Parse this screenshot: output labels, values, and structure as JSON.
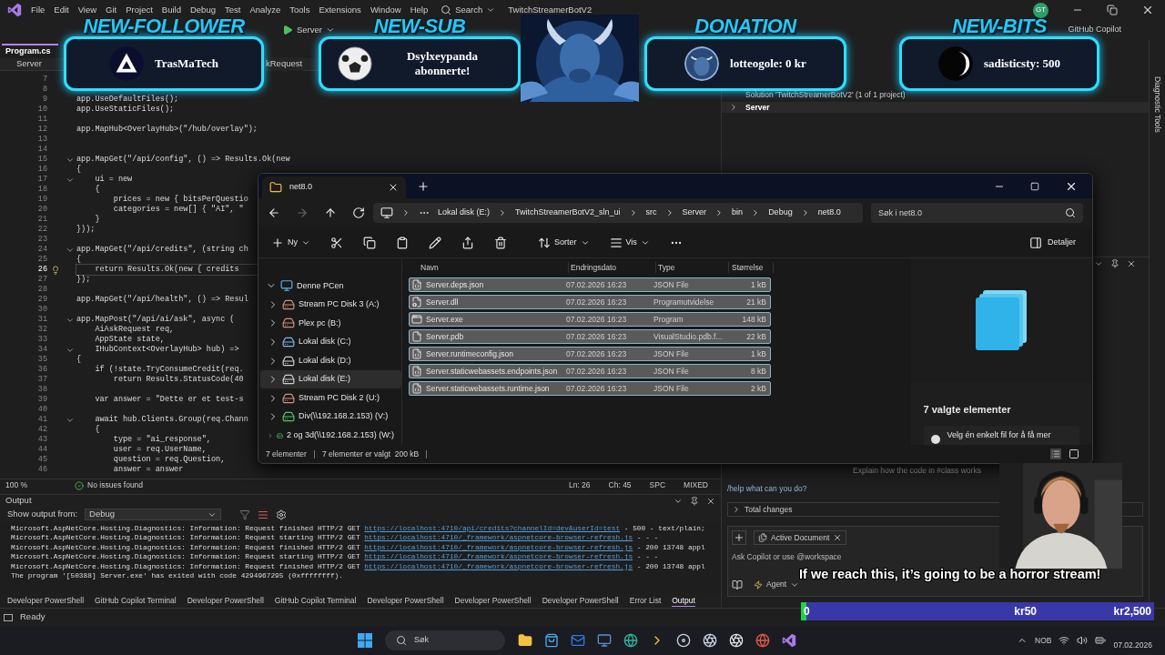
{
  "vs": {
    "title": "TwitchStreamerBotV2",
    "menu": [
      "File",
      "Edit",
      "View",
      "Git",
      "Project",
      "Build",
      "Debug",
      "Test",
      "Analyze",
      "Tools",
      "Extensions",
      "Window",
      "Help"
    ],
    "search": "Search",
    "account": "GT",
    "run_target": "Server",
    "copilot": "GitHub Copilot",
    "side_tab": "Diagnostic Tools"
  },
  "editor": {
    "tab": "Program.cs",
    "nav": [
      "Server",
      "kRequest"
    ],
    "lines": [
      {
        "n": "7",
        "fold": false,
        "current": false
      },
      {
        "n": "8",
        "fold": false,
        "current": false
      },
      {
        "n": "9",
        "code": "app.UseDefaultFiles();",
        "fold": false,
        "current": false
      },
      {
        "n": "10",
        "code": "app.UseStaticFiles();",
        "fold": false,
        "current": false
      },
      {
        "n": "11",
        "fold": false,
        "current": false
      },
      {
        "n": "12",
        "code": "app.MapHub<OverlayHub>(\"/hub/overlay\");",
        "fold": false,
        "current": false
      },
      {
        "n": "13",
        "fold": false,
        "current": false
      },
      {
        "n": "14",
        "fold": false,
        "current": false
      },
      {
        "n": "15",
        "code": "app.MapGet(\"/api/config\", () => Results.Ok(new",
        "fold": true,
        "current": false
      },
      {
        "n": "16",
        "code": "{",
        "fold": false,
        "current": false
      },
      {
        "n": "17",
        "code": "    ui = new",
        "fold": true,
        "current": false
      },
      {
        "n": "18",
        "code": "    {",
        "fold": false,
        "current": false
      },
      {
        "n": "19",
        "code": "        prices = new { bitsPerQuestio",
        "fold": false,
        "current": false
      },
      {
        "n": "20",
        "code": "        categories = new[] { \"AI\", \"",
        "fold": false,
        "current": false
      },
      {
        "n": "21",
        "code": "    }",
        "fold": false,
        "current": false
      },
      {
        "n": "22",
        "code": "}));",
        "fold": false,
        "current": false
      },
      {
        "n": "23",
        "fold": false,
        "current": false
      },
      {
        "n": "24",
        "code": "app.MapGet(\"/api/credits\", (string ch",
        "fold": true,
        "current": false
      },
      {
        "n": "25",
        "code": "{",
        "fold": false,
        "current": false
      },
      {
        "n": "26",
        "code": "    return Results.Ok(new { credits",
        "fold": false,
        "current": true
      },
      {
        "n": "27",
        "code": "});",
        "fold": false,
        "current": false
      },
      {
        "n": "28",
        "fold": false,
        "current": false
      },
      {
        "n": "29",
        "code": "app.MapGet(\"/api/health\", () => Resul",
        "fold": false,
        "current": false
      },
      {
        "n": "30",
        "fold": false,
        "current": false
      },
      {
        "n": "31",
        "code": "app.MapPost(\"/api/ai/ask\", async (",
        "fold": true,
        "current": false
      },
      {
        "n": "32",
        "code": "    AiAskRequest req,",
        "fold": false,
        "current": false
      },
      {
        "n": "33",
        "code": "    AppState state,",
        "fold": false,
        "current": false
      },
      {
        "n": "34",
        "code": "    IHubContext<OverlayHub> hub) =>",
        "fold": true,
        "current": false
      },
      {
        "n": "35",
        "code": "{",
        "fold": false,
        "current": false
      },
      {
        "n": "36",
        "code": "    if (!state.TryConsumeCredit(req.",
        "fold": false,
        "current": false
      },
      {
        "n": "37",
        "code": "        return Results.StatusCode(40",
        "fold": false,
        "current": false
      },
      {
        "n": "38",
        "fold": false,
        "current": false
      },
      {
        "n": "39",
        "code": "    var answer = \"Dette er et test-s",
        "fold": false,
        "current": false
      },
      {
        "n": "40",
        "fold": false,
        "current": false
      },
      {
        "n": "41",
        "code": "    await hub.Clients.Group(req.Chann",
        "fold": true,
        "current": false
      },
      {
        "n": "42",
        "code": "    {",
        "fold": false,
        "current": false
      },
      {
        "n": "43",
        "code": "        type = \"ai_response\",",
        "fold": false,
        "current": false
      },
      {
        "n": "44",
        "code": "        user = req.UserName,",
        "fold": false,
        "current": false
      },
      {
        "n": "45",
        "code": "        question = req.Question,",
        "fold": false,
        "current": false
      },
      {
        "n": "46",
        "code": "        answer = answer",
        "fold": false,
        "current": false
      }
    ],
    "zoom": "100 %",
    "issues": "No issues found",
    "position": [
      "Ln: 26",
      "Ch: 45",
      "SPC",
      "MIXED"
    ]
  },
  "solution": {
    "title": "Solution 'TwitchStreamerBotV2' (1 of 1 project)",
    "items": [
      {
        "label": "Server",
        "expanded": false
      }
    ]
  },
  "chat": {
    "hint": "Explain how the code in #class works",
    "suggestion": "/help what can you do?",
    "changes": "Total changes",
    "context": "Active Document",
    "input_placeholder": "Ask Copilot or use @workspace",
    "mode": "Agent"
  },
  "output": {
    "title": "Output",
    "source_label": "Show output from:",
    "source": "Debug",
    "lines": [
      {
        "text": "Microsoft.AspNetCore.Hosting.Diagnostics: Information: Request finished HTTP/2 GET ",
        "link": "https://localhost:4710/api/credits?channelId=dev&userId=test",
        "tail": " - 500 - text/plain;"
      },
      {
        "text": "Microsoft.AspNetCore.Hosting.Diagnostics: Information: Request starting HTTP/2 GET ",
        "link": "https://localhost:4710/_framework/aspnetcore-browser-refresh.js",
        "tail": " - - -"
      },
      {
        "text": "Microsoft.AspNetCore.Hosting.Diagnostics: Information: Request finished HTTP/2 GET ",
        "link": "https://localhost:4710/_framework/aspnetcore-browser-refresh.js",
        "tail": " - 200 13748 appl"
      },
      {
        "text": "Microsoft.AspNetCore.Hosting.Diagnostics: Information: Request starting HTTP/2 GET ",
        "link": "https://localhost:4710/_framework/aspnetcore-browser-refresh.js",
        "tail": " - - -"
      },
      {
        "text": "Microsoft.AspNetCore.Hosting.Diagnostics: Information: Request finished HTTP/2 GET ",
        "link": "https://localhost:4710/_framework/aspnetcore-browser-refresh.js",
        "tail": " - 200 13748 appl"
      },
      {
        "text": "The program '[50388] Server.exe' has exited with code 4294967295 (0xffffffff)."
      }
    ]
  },
  "bottom_tabs": [
    {
      "label": "Developer PowerShell",
      "selected": false
    },
    {
      "label": "GitHub Copilot Terminal",
      "selected": false
    },
    {
      "label": "Developer PowerShell",
      "selected": false
    },
    {
      "label": "GitHub Copilot Terminal",
      "selected": false
    },
    {
      "label": "Developer PowerShell",
      "selected": false
    },
    {
      "label": "Developer PowerShell",
      "selected": false
    },
    {
      "label": "Developer PowerShell",
      "selected": false
    },
    {
      "label": "Error List",
      "selected": false
    },
    {
      "label": "Output",
      "selected": true
    }
  ],
  "status": "Ready",
  "explorer": {
    "tab": "net8.0",
    "breadcrumbs": [
      "Lokal disk (E:)",
      "TwitchStreamerBotV2_sln_ui",
      "src",
      "Server",
      "bin",
      "Debug",
      "net8.0"
    ],
    "search_placeholder": "Søk i net8.0",
    "commands": [
      {
        "label": "Ny",
        "kind": "new"
      },
      {
        "kind": "cut"
      },
      {
        "kind": "copy"
      },
      {
        "kind": "paste"
      },
      {
        "kind": "rename"
      },
      {
        "kind": "share"
      },
      {
        "kind": "delete"
      },
      {
        "label": "Sorter",
        "kind": "sort"
      },
      {
        "label": "Vis",
        "kind": "view"
      },
      {
        "kind": "more"
      }
    ],
    "details_button": "Detaljer",
    "tree": [
      {
        "label": "Denne PCen",
        "kind": "pc",
        "expanded": true,
        "selected": false,
        "children": [
          {
            "label": "Stream PC Disk 3 (A:)",
            "kind": "usb",
            "expanded": false,
            "selected": false
          },
          {
            "label": "Plex pc (B:)",
            "kind": "usb",
            "expanded": false,
            "selected": false
          },
          {
            "label": "Lokal disk (C:)",
            "kind": "system",
            "expanded": false,
            "selected": false
          },
          {
            "label": "Lokal disk (D:)",
            "kind": "drive",
            "expanded": false,
            "selected": false
          },
          {
            "label": "Lokal disk (E:)",
            "kind": "drive",
            "expanded": false,
            "selected": true
          },
          {
            "label": "Stream PC Disk 2 (U:)",
            "kind": "usb",
            "expanded": false,
            "selected": false
          },
          {
            "label": "Div(\\\\192.168.2.153) (V:)",
            "kind": "network",
            "expanded": false,
            "selected": false
          },
          {
            "label": "2  og 3d(\\\\192.168.2.153) (W:)",
            "kind": "network",
            "expanded": false,
            "selected": false
          }
        ]
      }
    ],
    "columns": [
      "Navn",
      "Endringsdato",
      "Type",
      "Størrelse"
    ],
    "files": [
      {
        "name": "Server.deps.json",
        "date": "07.02.2026 16:23",
        "type": "JSON File",
        "size": "1 kB",
        "kind": "json",
        "selected": true
      },
      {
        "name": "Server.dll",
        "date": "07.02.2026 16:23",
        "type": "Programutvidelse",
        "size": "21 kB",
        "kind": "dll",
        "selected": true
      },
      {
        "name": "Server.exe",
        "date": "07.02.2026 16:23",
        "type": "Program",
        "size": "148 kB",
        "kind": "exe",
        "selected": true
      },
      {
        "name": "Server.pdb",
        "date": "07.02.2026 16:23",
        "type": "VisualStudio.pdb.f...",
        "size": "22 kB",
        "kind": "pdb",
        "selected": true
      },
      {
        "name": "Server.runtimeconfig.json",
        "date": "07.02.2026 16:23",
        "type": "JSON File",
        "size": "1 kB",
        "kind": "json",
        "selected": true
      },
      {
        "name": "Server.staticwebassets.endpoints.json",
        "date": "07.02.2026 16:23",
        "type": "JSON File",
        "size": "8 kB",
        "kind": "json",
        "selected": true
      },
      {
        "name": "Server.staticwebassets.runtime.json",
        "date": "07.02.2026 16:23",
        "type": "JSON File",
        "size": "2 kB",
        "kind": "json",
        "selected": true
      }
    ],
    "details_title": "7 valgte elementer",
    "details_hint": "Velg én enkelt fil for å få mer",
    "count": "7 elementer",
    "selection": "7 elementer er valgt  200 kB"
  },
  "taskbar": {
    "search": "Søk",
    "language": "NOB",
    "date": "07.02.2026"
  },
  "alerts": [
    {
      "heading": "NEW-FOLLOWER",
      "text": "TrasMaTech",
      "kind": "triangle"
    },
    {
      "heading": "NEW-SUB",
      "text": "Dsylxeypanda abonnerte!",
      "kind": "ball"
    },
    {
      "heading": "DONATION",
      "text": "lotteogole: 0 kr",
      "kind": "portrait"
    },
    {
      "heading": "NEW-BITS",
      "text": "sadisticsty: 500",
      "kind": "crescent"
    }
  ],
  "goal": {
    "text": "If we reach this, it’s going to be a horror stream!",
    "level": 0.015,
    "labels": [
      "0",
      "kr50",
      "kr2,500"
    ]
  }
}
